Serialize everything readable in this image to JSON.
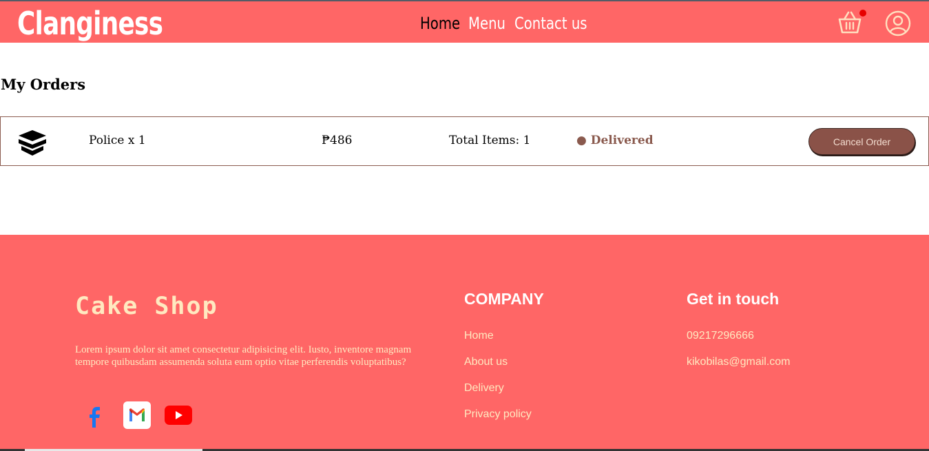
{
  "header": {
    "brand": "Clanginess",
    "nav": [
      {
        "label": "Home"
      },
      {
        "label": "Menu"
      },
      {
        "label": "Contact us"
      }
    ],
    "cart_icon": "basket-icon",
    "user_icon": "user-circle-icon"
  },
  "orders": {
    "title": "My Orders",
    "items": [
      {
        "icon": "open-box-icon",
        "name": "Police x 1",
        "price": "₱486",
        "total_items": "Total Items: 1",
        "status": "● Delivered",
        "cancel_label": "Cancel Order"
      }
    ]
  },
  "footer": {
    "shop_name": "Cake Shop",
    "description": "Lorem ipsum dolor sit amet consectetur adipisicing elit. Iusto, inventore magnam tempore quibusdam assumenda soluta eum optio vitae perferendis voluptatibus?",
    "social": [
      "facebook-icon",
      "gmail-icon",
      "youtube-icon"
    ],
    "company": {
      "title": "COMPANY",
      "links": [
        "Home",
        "About us",
        "Delivery",
        "Privacy policy"
      ]
    },
    "contact": {
      "title": "Get in touch",
      "phone": "09217296666",
      "email": "kikobilas@gmail.com"
    }
  },
  "colors": {
    "brand": "#ff6666",
    "accent": "#8a5248",
    "footer_text": "#ffe9c0"
  }
}
